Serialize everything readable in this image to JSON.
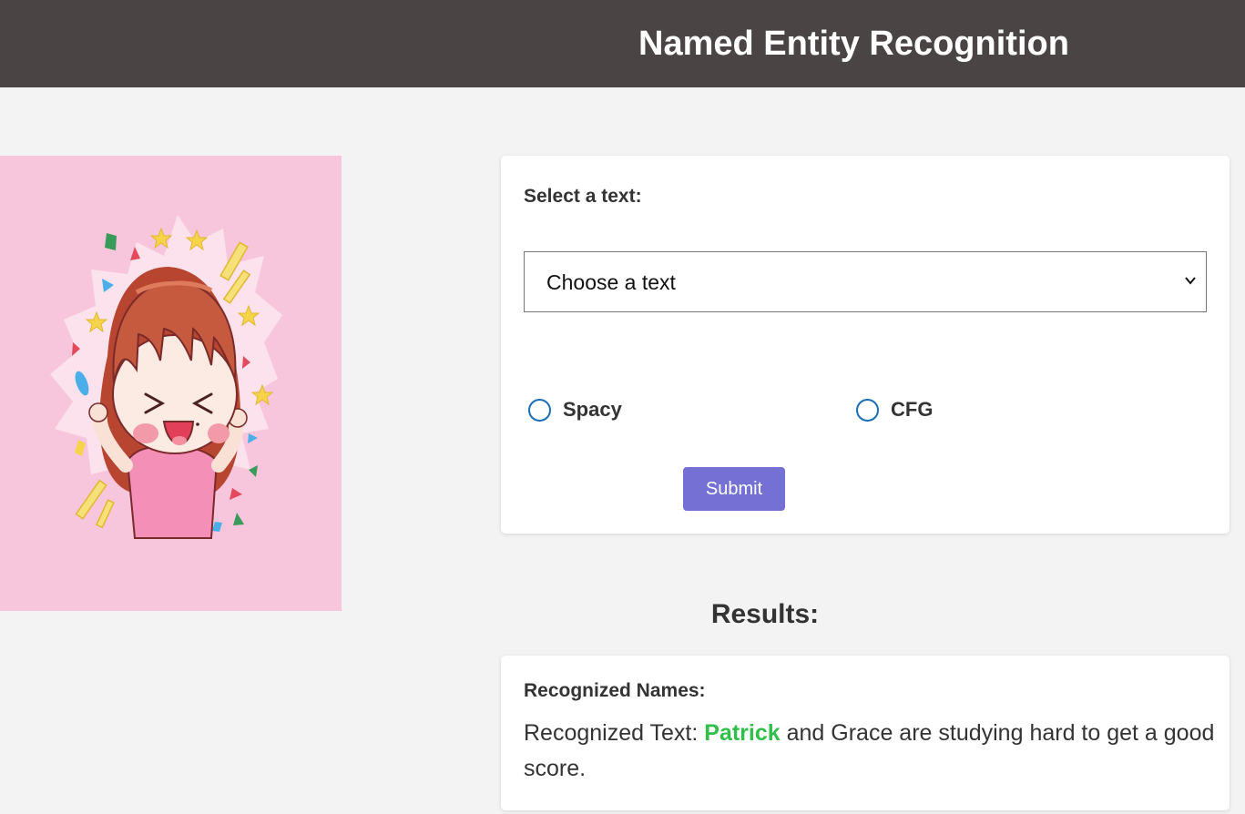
{
  "header": {
    "title": "Named Entity Recognition"
  },
  "form": {
    "label": "Select a text:",
    "select": {
      "selected": "Choose a text"
    },
    "radios": [
      {
        "label": "Spacy",
        "checked": false
      },
      {
        "label": "CFG",
        "checked": false
      }
    ],
    "submit_label": "Submit"
  },
  "results": {
    "title": "Results:",
    "label": "Recognized Names:",
    "prefix": "Recognized Text: ",
    "entity": "Patrick",
    "rest": " and Grace are studying hard to get a good score."
  },
  "colors": {
    "header_bg": "#4a4544",
    "accent": "#7571d4",
    "entity": "#2fbf4a",
    "illustration_bg": "#f8c6dc"
  },
  "icons": {
    "illustration": "cheering-girl-illustration",
    "select_arrow": "chevron-down-icon"
  }
}
